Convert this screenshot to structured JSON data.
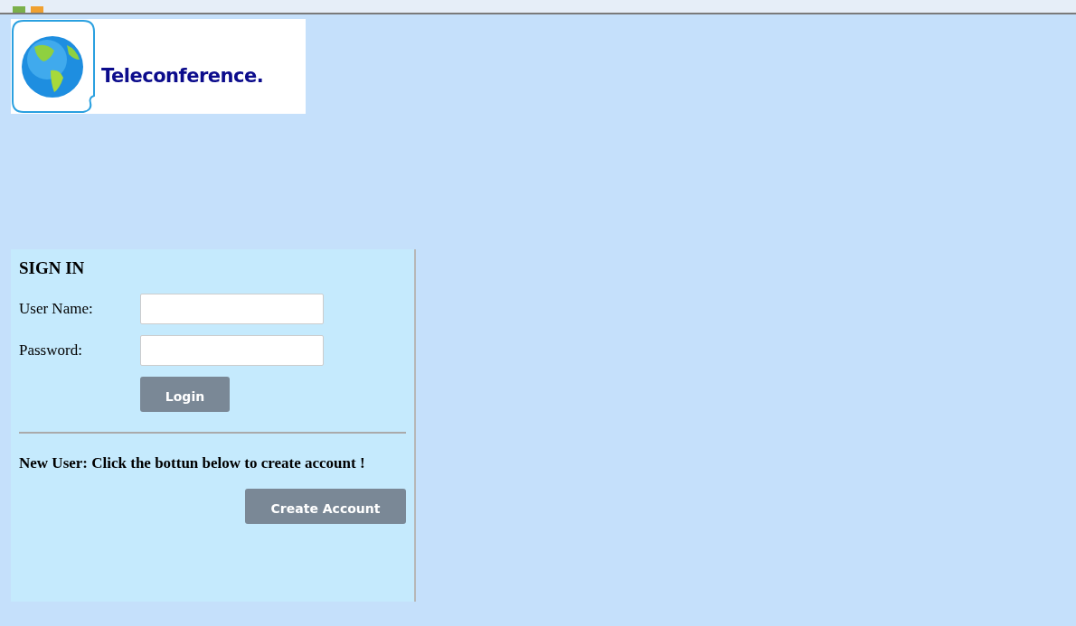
{
  "logo": {
    "text": "Teleconference."
  },
  "sign_in": {
    "title": "SIGN IN",
    "fields": [
      {
        "label": "User Name:"
      },
      {
        "label": "Password:"
      }
    ],
    "login_button": "Login",
    "new_user_text": "New User: Click the bottun below to create account !",
    "create_button": "Create Account"
  }
}
